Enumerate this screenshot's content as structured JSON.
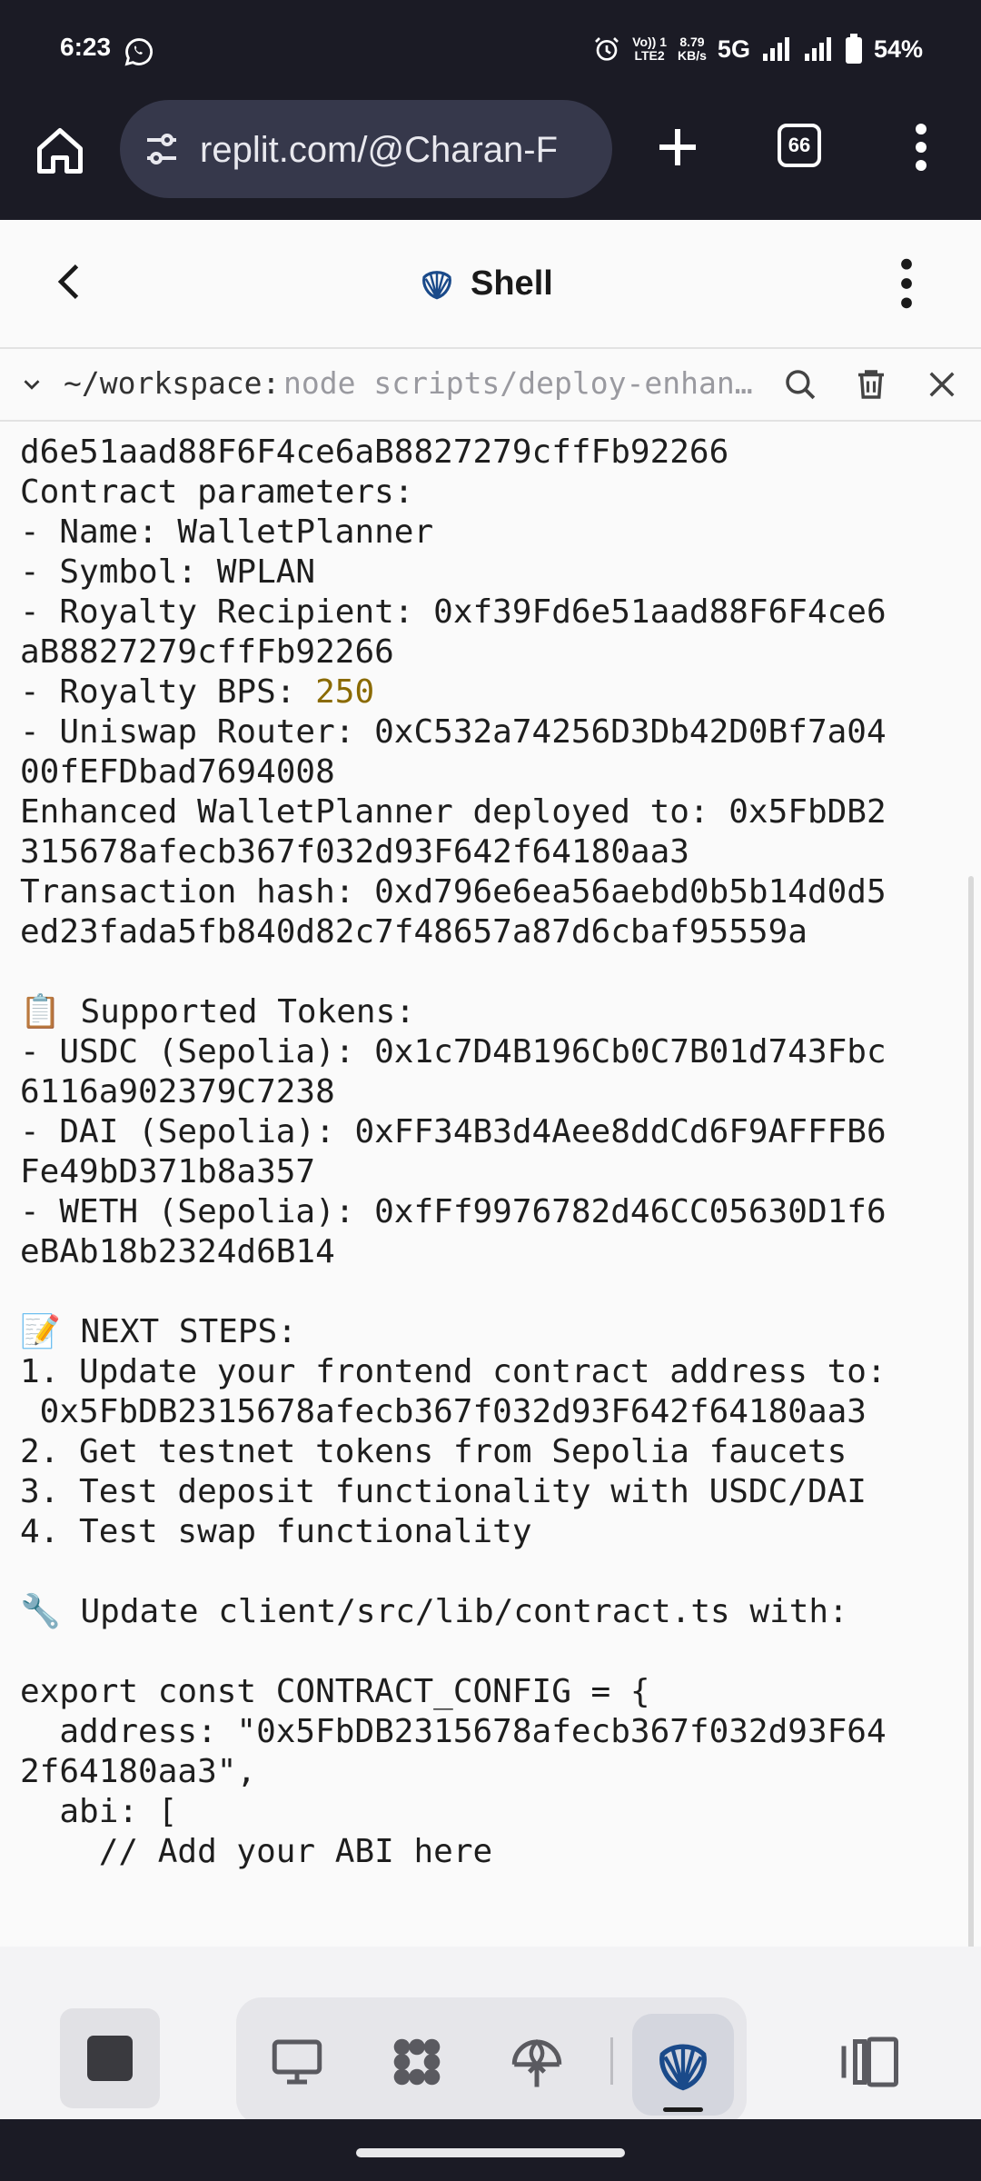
{
  "status_bar": {
    "time": "6:23",
    "volte_top": "Vo)) 1",
    "volte_bottom": "LTE2",
    "speed_top": "8.79",
    "speed_bottom": "KB/s",
    "network": "5G",
    "battery": "54%",
    "icons": [
      "whatsapp-icon",
      "alarm-icon",
      "signal-icon",
      "battery-icon"
    ]
  },
  "browser": {
    "url": "replit.com/@Charan-F",
    "tab_count": "66",
    "icons": [
      "home-icon",
      "site-settings-icon",
      "new-tab-icon",
      "menu-icon"
    ]
  },
  "header": {
    "title": "Shell"
  },
  "cwd_bar": {
    "path": "~/workspace:",
    "command": "node scripts/deploy-enhanced-wallet-planner.js",
    "icons": [
      "search-icon",
      "trash-icon",
      "close-icon"
    ]
  },
  "terminal": {
    "lines": [
      "d6e51aad88F6F4ce6aB8827279cffFb92266",
      "Contract parameters:",
      "- Name: WalletPlanner",
      "- Symbol: WPLAN",
      "- Royalty Recipient: 0xf39Fd6e51aad88F6F4ce6",
      "aB8827279cffFb92266",
      "- Royalty BPS: ",
      "- Uniswap Router: 0xC532a74256D3Db42D0Bf7a04",
      "00fEFDbad7694008",
      "Enhanced WalletPlanner deployed to: 0x5FbDB2",
      "315678afecb367f032d93F642f64180aa3",
      "Transaction hash: 0xd796e6ea56aebd0b5b14d0d5",
      "ed23fada5fb840d82c7f48657a87d6cbaf95559a",
      "",
      "📋 Supported Tokens:",
      "- USDC (Sepolia): 0x1c7D4B196Cb0C7B01d743Fbc",
      "6116a902379C7238",
      "- DAI (Sepolia): 0xFF34B3d4Aee8ddCd6F9AFFFB6",
      "Fe49bD371b8a357",
      "- WETH (Sepolia): 0xfFf9976782d46CC05630D1f6",
      "eBAb18b2324d6B14",
      "",
      "📝 NEXT STEPS:",
      "1. Update your frontend contract address to:",
      " 0x5FbDB2315678afecb367f032d93F642f64180aa3",
      "2. Get testnet tokens from Sepolia faucets",
      "3. Test deposit functionality with USDC/DAI",
      "4. Test swap functionality",
      "",
      "🔧 Update client/src/lib/contract.ts with:",
      "",
      "export const CONTRACT_CONFIG = {",
      "  address: \"0x5FbDB2315678afecb367f032d93F64",
      "2f64180aa3\",",
      "  abi: [",
      "    // Add your ABI here"
    ],
    "royalty_bps_value": "250"
  },
  "bottom_toolbar": {
    "icons": [
      "stop-icon",
      "webview-icon",
      "workspace-icon",
      "deployments-icon",
      "shell-icon",
      "panels-icon"
    ]
  },
  "colors": {
    "system_bar": "#1b1b25",
    "url_pill": "#36384b",
    "terminal_bg": "#fafafa",
    "terminal_text": "#1e1e1e",
    "number_highlight": "#8a6a00",
    "shell_icon": "#1a4a8a"
  }
}
